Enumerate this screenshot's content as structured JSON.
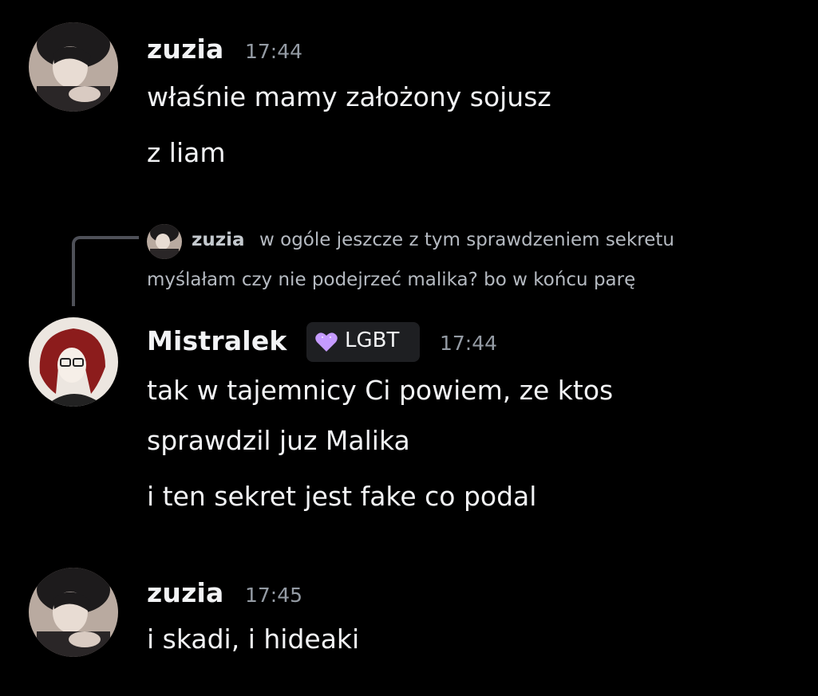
{
  "messages": [
    {
      "username": "zuzia",
      "time": "17:44",
      "lines": [
        "właśnie mamy założony sojusz",
        "z liam"
      ]
    },
    {
      "reply": {
        "username": "zuzia",
        "text_line1": "w ogóle jeszcze z tym sprawdzeniem sekretu",
        "text_line2": "myślałam czy nie podejrzeć malika? bo w końcu parę"
      },
      "username": "Mistralek",
      "badge": {
        "icon": "purple-heart-icon",
        "label": "LGBT",
        "color": "#c59bff"
      },
      "time": "17:44",
      "lines": [
        "tak w tajemnicy Ci powiem, ze ktos",
        "sprawdzil juz Malika",
        "i ten sekret jest fake co podal"
      ]
    },
    {
      "username": "zuzia",
      "time": "17:45",
      "lines": [
        "i skadi, i hideaki"
      ]
    }
  ],
  "colors": {
    "background": "#000000",
    "text": "#f2f3f5",
    "muted": "#949ba4"
  }
}
